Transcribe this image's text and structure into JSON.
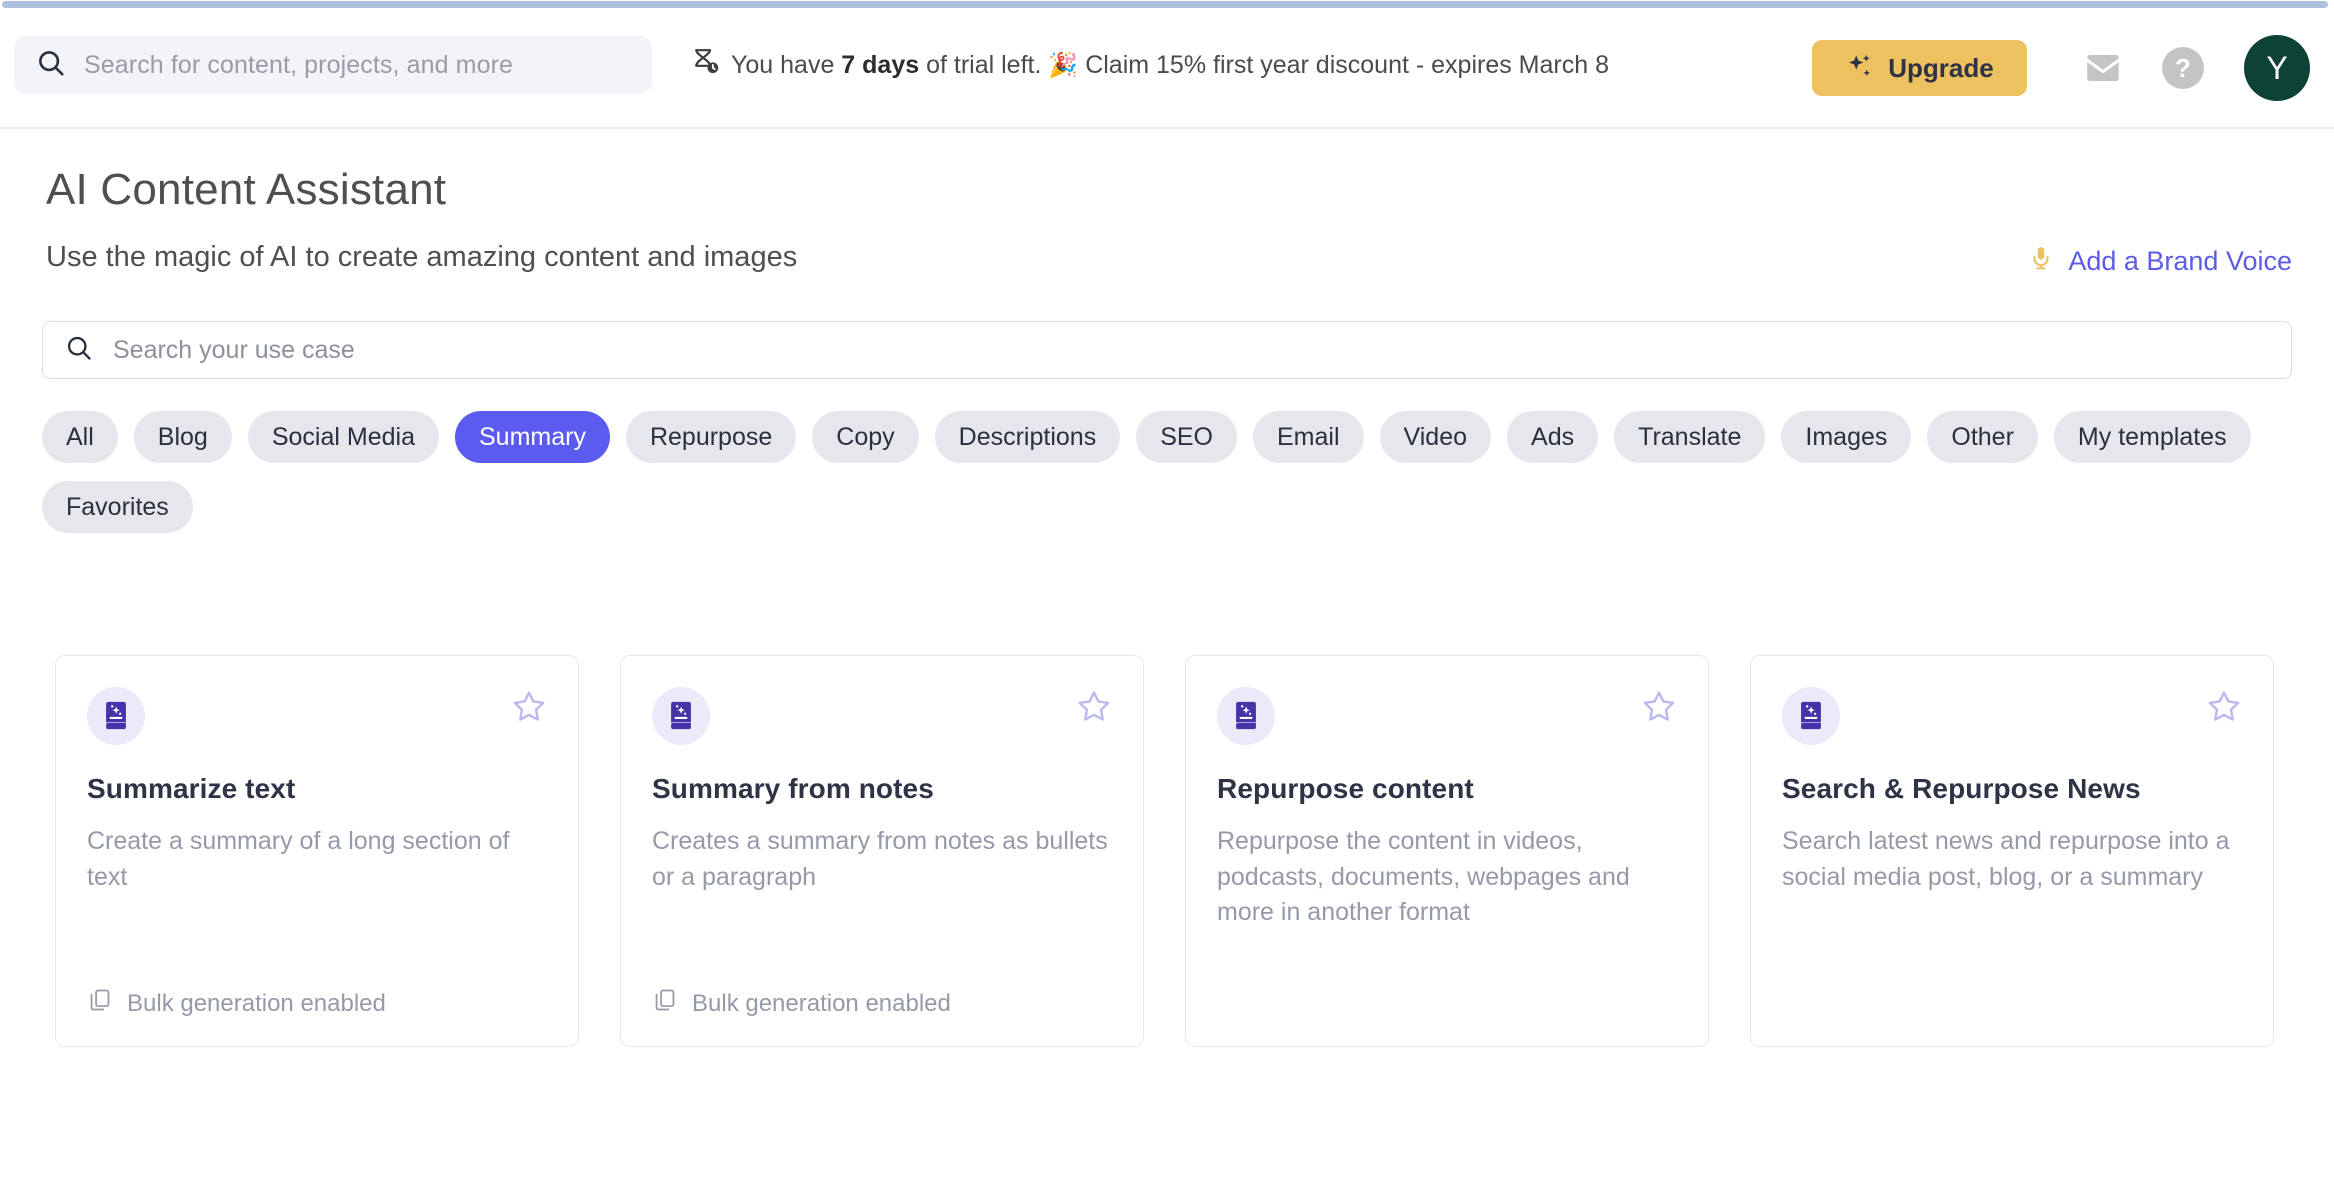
{
  "header": {
    "global_search": {
      "placeholder": "Search for content, projects, and more",
      "icon": "search-icon"
    },
    "trial": {
      "icon": "hourglass-clock-icon",
      "prefix": "You have ",
      "days": "7 days",
      "middle": " of trial left. ",
      "emoji": "🎉",
      "suffix": " Claim 15% first year discount - expires March 8"
    },
    "upgrade_label": "Upgrade",
    "mail_icon": "mail-icon",
    "help_label": "?",
    "avatar_initial": "Y"
  },
  "page": {
    "title": "AI Content Assistant",
    "subtitle": "Use the magic of AI to create amazing content and images",
    "brand_voice_label": "Add a Brand Voice",
    "brand_voice_icon": "microphone-icon"
  },
  "usecase_search": {
    "placeholder": "Search your use case",
    "icon": "search-icon"
  },
  "filters": {
    "chips": [
      {
        "label": "All",
        "active": false
      },
      {
        "label": "Blog",
        "active": false
      },
      {
        "label": "Social Media",
        "active": false
      },
      {
        "label": "Summary",
        "active": true
      },
      {
        "label": "Repurpose",
        "active": false
      },
      {
        "label": "Copy",
        "active": false
      },
      {
        "label": "Descriptions",
        "active": false
      },
      {
        "label": "SEO",
        "active": false
      },
      {
        "label": "Email",
        "active": false
      },
      {
        "label": "Video",
        "active": false
      },
      {
        "label": "Ads",
        "active": false
      },
      {
        "label": "Translate",
        "active": false
      },
      {
        "label": "Images",
        "active": false
      },
      {
        "label": "Other",
        "active": false
      },
      {
        "label": "My templates",
        "active": false
      },
      {
        "label": "Favorites",
        "active": false
      }
    ]
  },
  "cards": [
    {
      "icon": "magic-book-icon",
      "title": "Summarize text",
      "description": "Create a summary of a long section of text",
      "footer": "Bulk generation enabled",
      "has_footer": true,
      "starred": false
    },
    {
      "icon": "magic-book-icon",
      "title": "Summary from notes",
      "description": "Creates a summary from notes as bullets or a paragraph",
      "footer": "Bulk generation enabled",
      "has_footer": true,
      "starred": false
    },
    {
      "icon": "magic-book-icon",
      "title": "Repurpose content",
      "description": "Repurpose the content in videos, podcasts, documents, webpages and more in another format",
      "footer": "",
      "has_footer": false,
      "starred": false
    },
    {
      "icon": "magic-book-icon",
      "title": "Search & Repurpose News",
      "description": "Search latest news and repurpose into a social media post, blog, or a summary",
      "footer": "",
      "has_footer": false,
      "starred": false
    }
  ],
  "colors": {
    "accent_purple": "#5b5bf0",
    "upgrade_yellow": "#edc160",
    "avatar_green": "#0f4237",
    "card_icon_purple": "#4733a8",
    "scrollbar": "#aebfdc"
  }
}
